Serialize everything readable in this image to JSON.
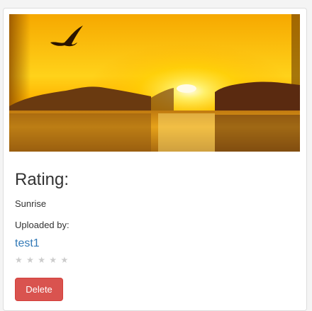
{
  "card": {
    "rating_heading": "Rating:",
    "title": "Sunrise",
    "uploaded_by_label": "Uploaded by:",
    "uploader": "test1",
    "rating_stars": 0,
    "rating_max": 5,
    "star_glyph": "★",
    "delete_label": "Delete",
    "image_description_icon": "sunrise-over-sea-image"
  },
  "colors": {
    "link": "#337ab7",
    "danger": "#d9534f",
    "star_empty": "#cccccc"
  }
}
